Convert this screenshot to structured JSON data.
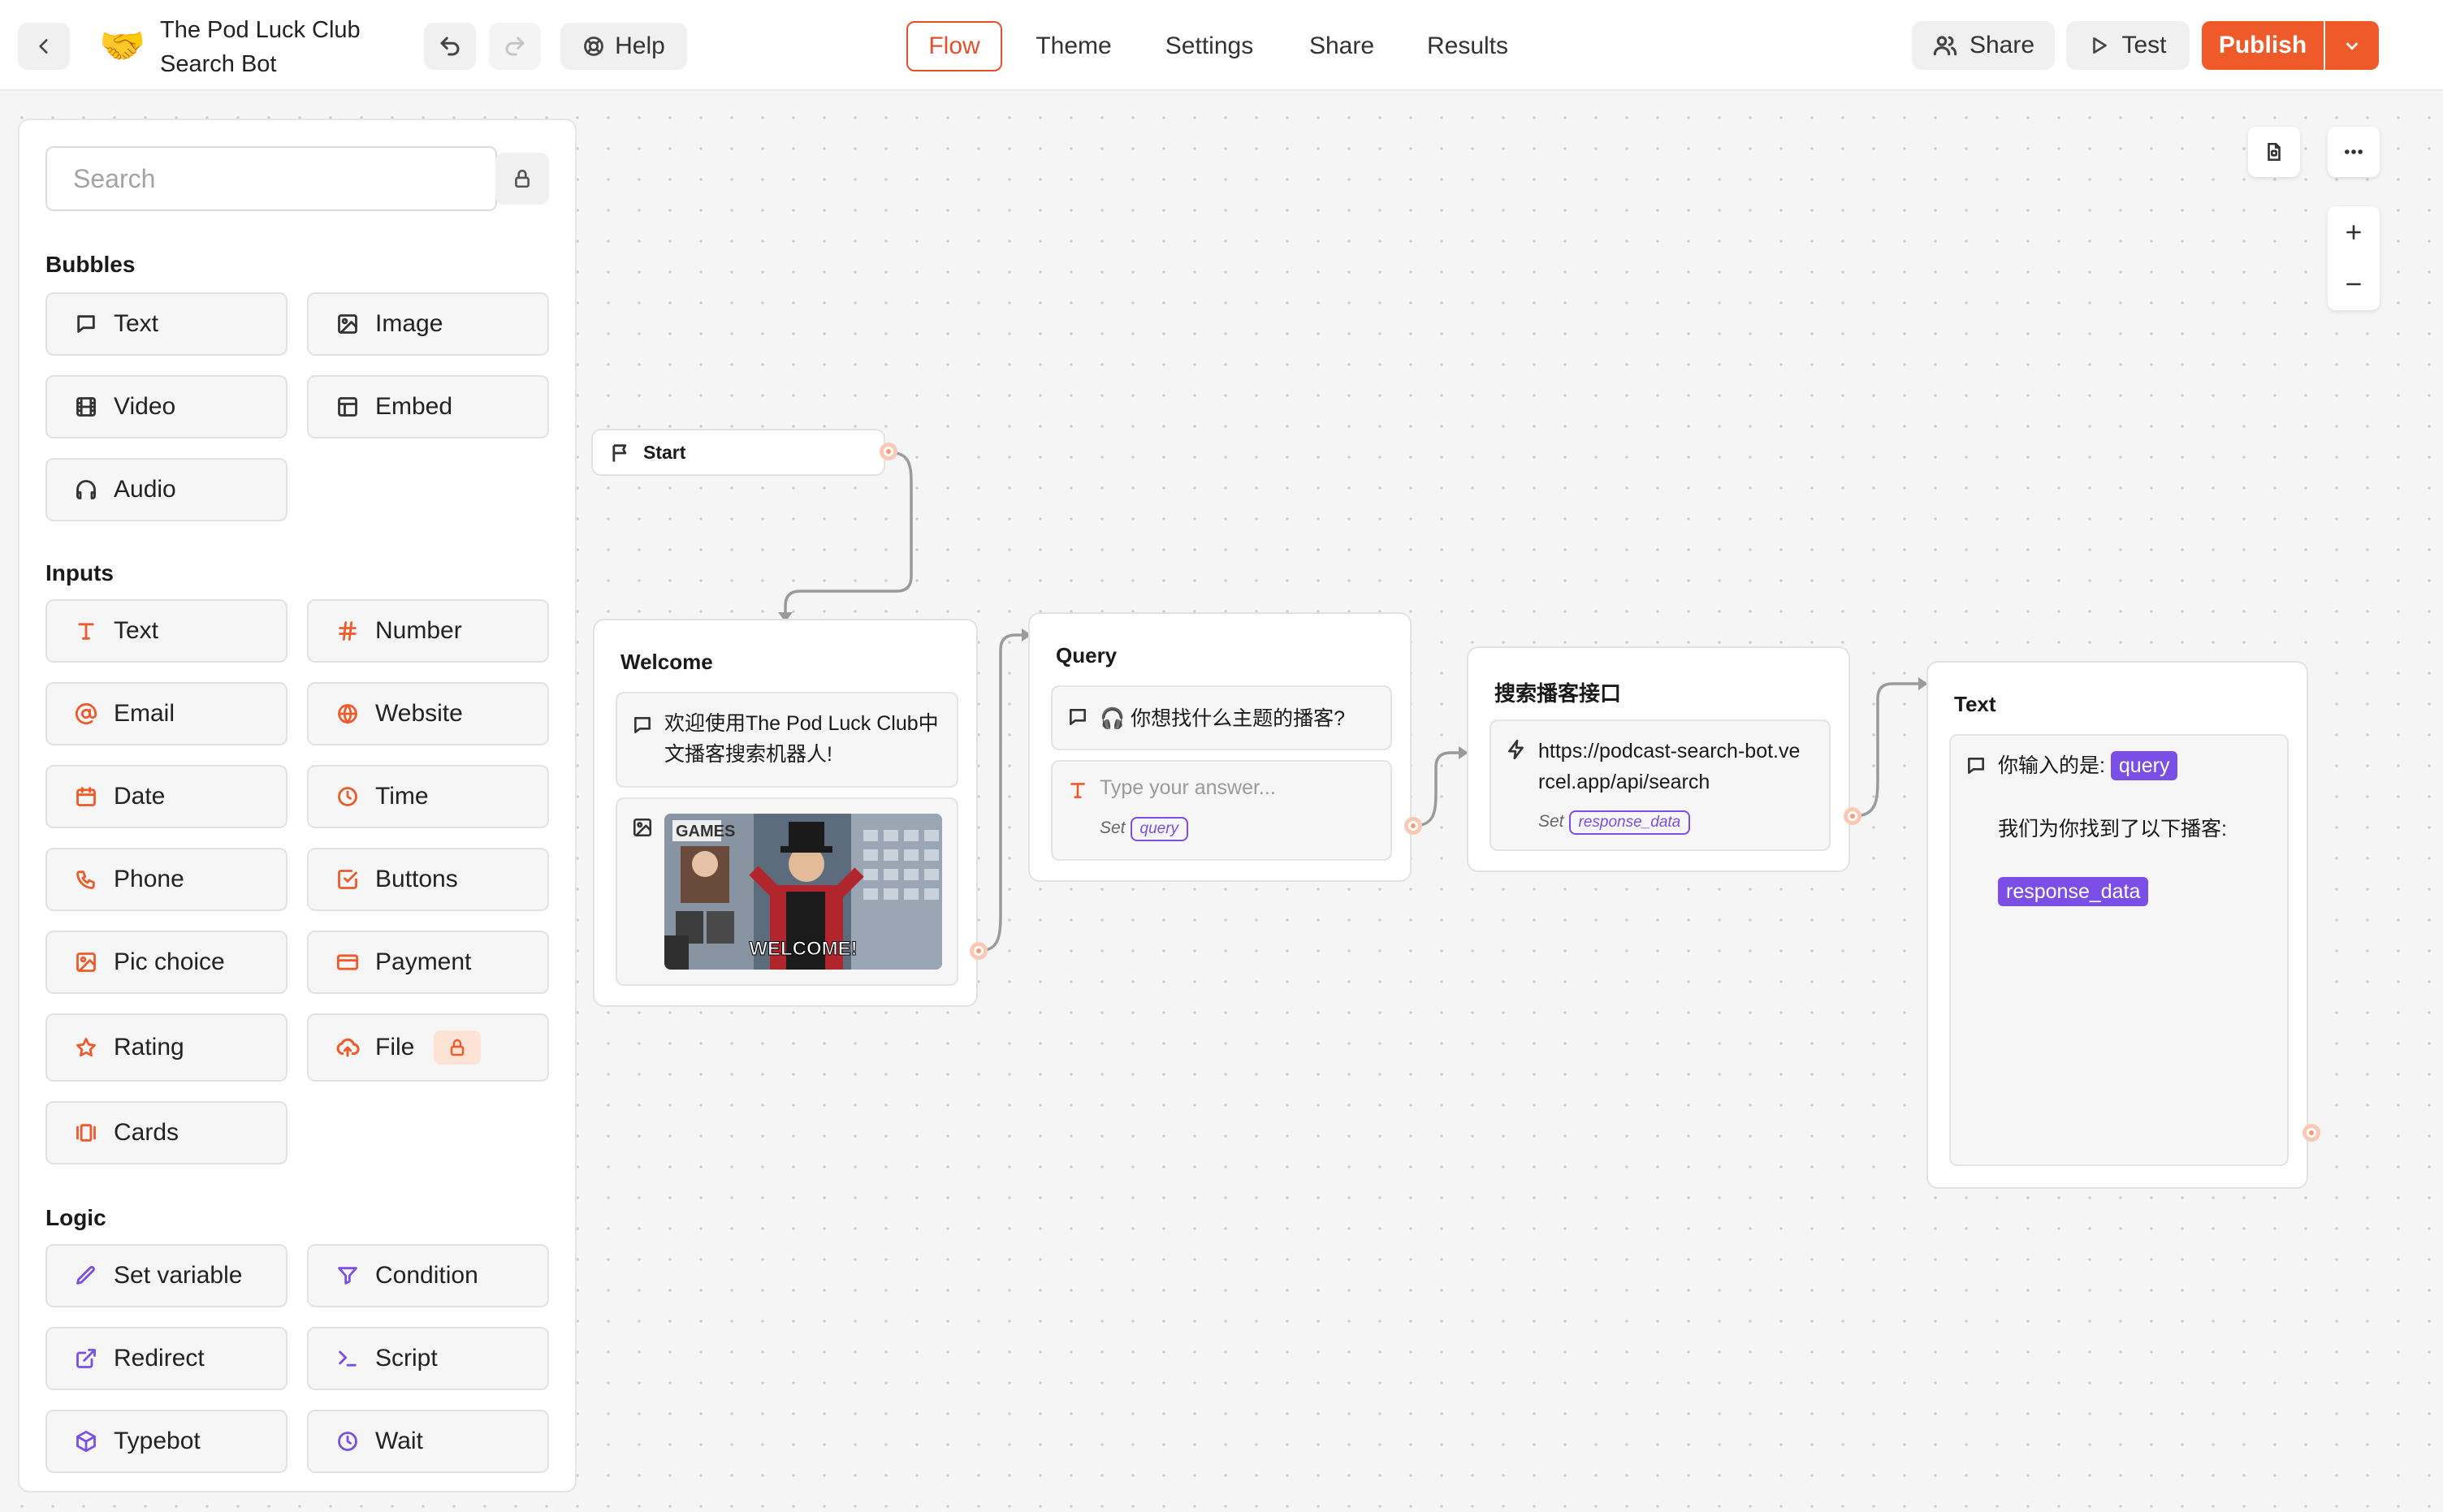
{
  "header": {
    "bot_name": "The Pod Luck Club Search Bot",
    "logo_emoji": "🤝",
    "help_label": "Help",
    "tabs": [
      "Flow",
      "Theme",
      "Settings",
      "Share",
      "Results"
    ],
    "active_tab": "Flow",
    "share_label": "Share",
    "test_label": "Test",
    "publish_label": "Publish",
    "accent_color": "#ef5a2b"
  },
  "sidebar": {
    "search_placeholder": "Search",
    "sections": {
      "bubbles": {
        "title": "Bubbles",
        "items": [
          "Text",
          "Image",
          "Video",
          "Embed",
          "Audio"
        ]
      },
      "inputs": {
        "title": "Inputs",
        "items": [
          "Text",
          "Number",
          "Email",
          "Website",
          "Date",
          "Time",
          "Phone",
          "Buttons",
          "Pic choice",
          "Payment",
          "Rating",
          "File",
          "Cards"
        ]
      },
      "logic": {
        "title": "Logic",
        "items": [
          "Set variable",
          "Condition",
          "Redirect",
          "Script",
          "Typebot",
          "Wait"
        ]
      }
    }
  },
  "flow": {
    "start": {
      "label": "Start"
    },
    "welcome": {
      "title": "Welcome",
      "text": "欢迎使用The Pod Luck Club中文播客搜索机器人!",
      "gif_caption": "WELCOME!",
      "gif_sign": "GAMES"
    },
    "query": {
      "title": "Query",
      "text": "🎧 你想找什么主题的播客?",
      "input_placeholder": "Type your answer...",
      "set_label": "Set",
      "variable": "query"
    },
    "api": {
      "title": "搜索播客接口",
      "url": "https://podcast-search-bot.vercel.app/api/search",
      "set_label": "Set",
      "variable": "response_data"
    },
    "text_node": {
      "title": "Text",
      "prefix": "你输入的是:",
      "var1": "query",
      "line2": "我们为你找到了以下播客:",
      "var2": "response_data"
    },
    "variable_color": "#7b4ee6"
  }
}
